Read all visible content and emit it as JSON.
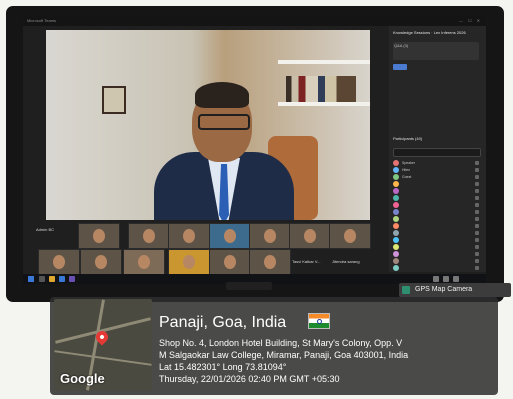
{
  "meeting": {
    "window_label": "Microsoft Teams",
    "window_controls": "— ☐ ✕",
    "thumbnails": [
      {
        "name": "Admin BC"
      },
      {
        "name": ""
      },
      {
        "name": ""
      },
      {
        "name": ""
      },
      {
        "name": ""
      },
      {
        "name": ""
      },
      {
        "name": ""
      },
      {
        "name": ""
      },
      {
        "name": ""
      },
      {
        "name": ""
      },
      {
        "name": ""
      },
      {
        "name": ""
      },
      {
        "name": ""
      },
      {
        "name": "Tasvi Katkar V..."
      },
      {
        "name": "Jitendra sarang"
      }
    ],
    "panel": {
      "title": "Knowledge Sessions · Lex Inferens 2026",
      "qa_label": "Q&A (3)",
      "participants_label": "Participants (40)",
      "participants": [
        {
          "name": "Speaker",
          "color": "#e57373"
        },
        {
          "name": "Hiten",
          "color": "#64b5f6"
        },
        {
          "name": "Guest",
          "color": "#81c784"
        },
        {
          "name": "",
          "color": "#ffb74d"
        },
        {
          "name": "",
          "color": "#ba68c8"
        },
        {
          "name": "",
          "color": "#4db6ac"
        },
        {
          "name": "",
          "color": "#f06292"
        },
        {
          "name": "",
          "color": "#7986cb"
        },
        {
          "name": "",
          "color": "#aed581"
        },
        {
          "name": "",
          "color": "#ff8a65"
        },
        {
          "name": "",
          "color": "#90a4ae"
        },
        {
          "name": "",
          "color": "#4fc3f7"
        },
        {
          "name": "",
          "color": "#dce775"
        },
        {
          "name": "",
          "color": "#ce93d8"
        },
        {
          "name": "",
          "color": "#a1887f"
        },
        {
          "name": "",
          "color": "#80cbc4"
        }
      ]
    }
  },
  "gps_chip": {
    "label": "GPS Map Camera"
  },
  "location": {
    "city_line": "Panaji, Goa, India",
    "address_line1": "Shop No. 4, London Hotel Building, St Mary's Colony, Opp. V",
    "address_line2": "M Salgaokar Law College, Miramar, Panaji, Goa 403001, India",
    "lat_long": "Lat 15.482301° Long 73.81094°",
    "datetime": "Thursday, 22/01/2026 02:40 PM GMT +05:30",
    "map_brand": "Google"
  }
}
